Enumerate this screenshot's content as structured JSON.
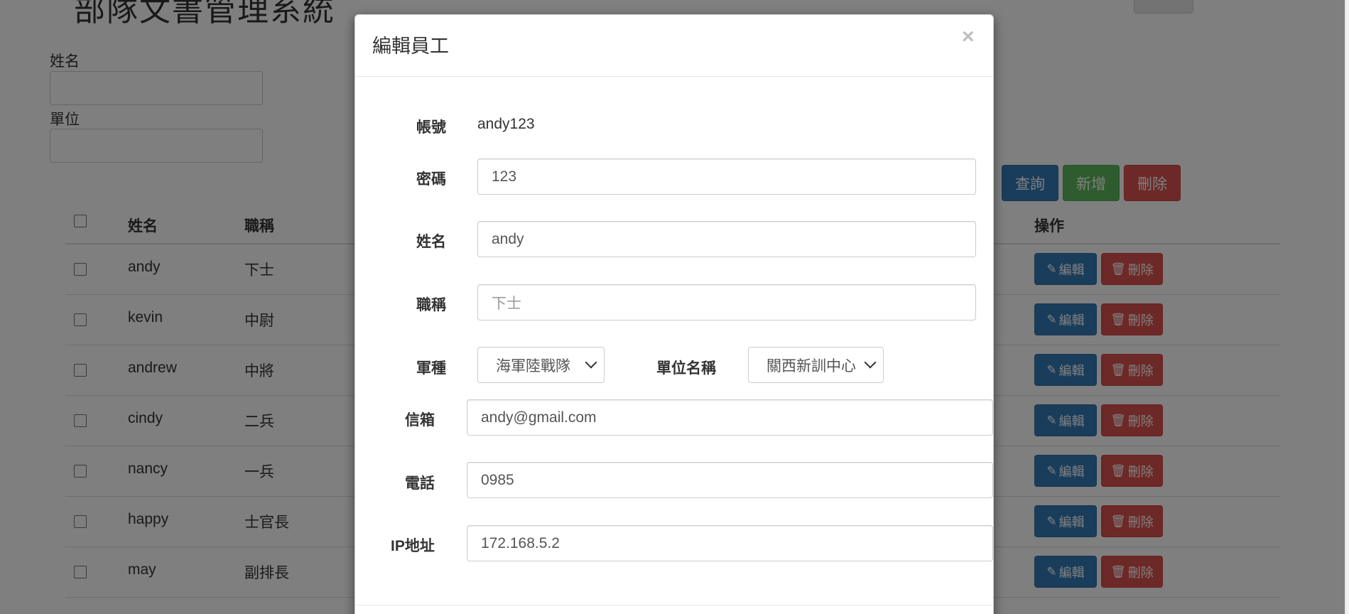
{
  "app": {
    "title": "部隊文書管理系統"
  },
  "filters": {
    "name_label": "姓名",
    "name_value": "",
    "unit_label": "單位",
    "unit_value": ""
  },
  "actions": {
    "query": "查詢",
    "add": "新增",
    "delete": "刪除"
  },
  "table": {
    "headers": {
      "name": "姓名",
      "rank": "職稱",
      "operation": "操作"
    },
    "edit_label": "編輯",
    "delete_label": "刪除",
    "rows": [
      {
        "name": "andy",
        "rank": "下士"
      },
      {
        "name": "kevin",
        "rank": "中尉"
      },
      {
        "name": "andrew",
        "rank": "中將"
      },
      {
        "name": "cindy",
        "rank": "二兵"
      },
      {
        "name": "nancy",
        "rank": "一兵"
      },
      {
        "name": "happy",
        "rank": "士官長"
      },
      {
        "name": "may",
        "rank": "副排長"
      }
    ]
  },
  "modal": {
    "title": "編輯員工",
    "close": "×",
    "account_label": "帳號",
    "account_value": "andy123",
    "password_label": "密碼",
    "password_value": "123",
    "name_label": "姓名",
    "name_value": "andy",
    "rank_label": "職稱",
    "rank_placeholder": "下士",
    "branch_label": "軍種",
    "branch_value": "海軍陸戰隊",
    "unit_label": "單位名稱",
    "unit_value": "關西新訓中心",
    "email_label": "信箱",
    "email_value": "andy@gmail.com",
    "phone_label": "電話",
    "phone_value": "0985",
    "ip_label": "IP地址",
    "ip_value": "172.168.5.2"
  },
  "colors": {
    "primary": "#337ab7",
    "success": "#5cb85c",
    "danger": "#d9534f",
    "backdrop": "rgba(0,0,0,0.5)"
  },
  "icons": {
    "edit": "pencil-icon",
    "delete": "trash-icon",
    "close": "close-icon",
    "select": "chevron-down-icon"
  }
}
